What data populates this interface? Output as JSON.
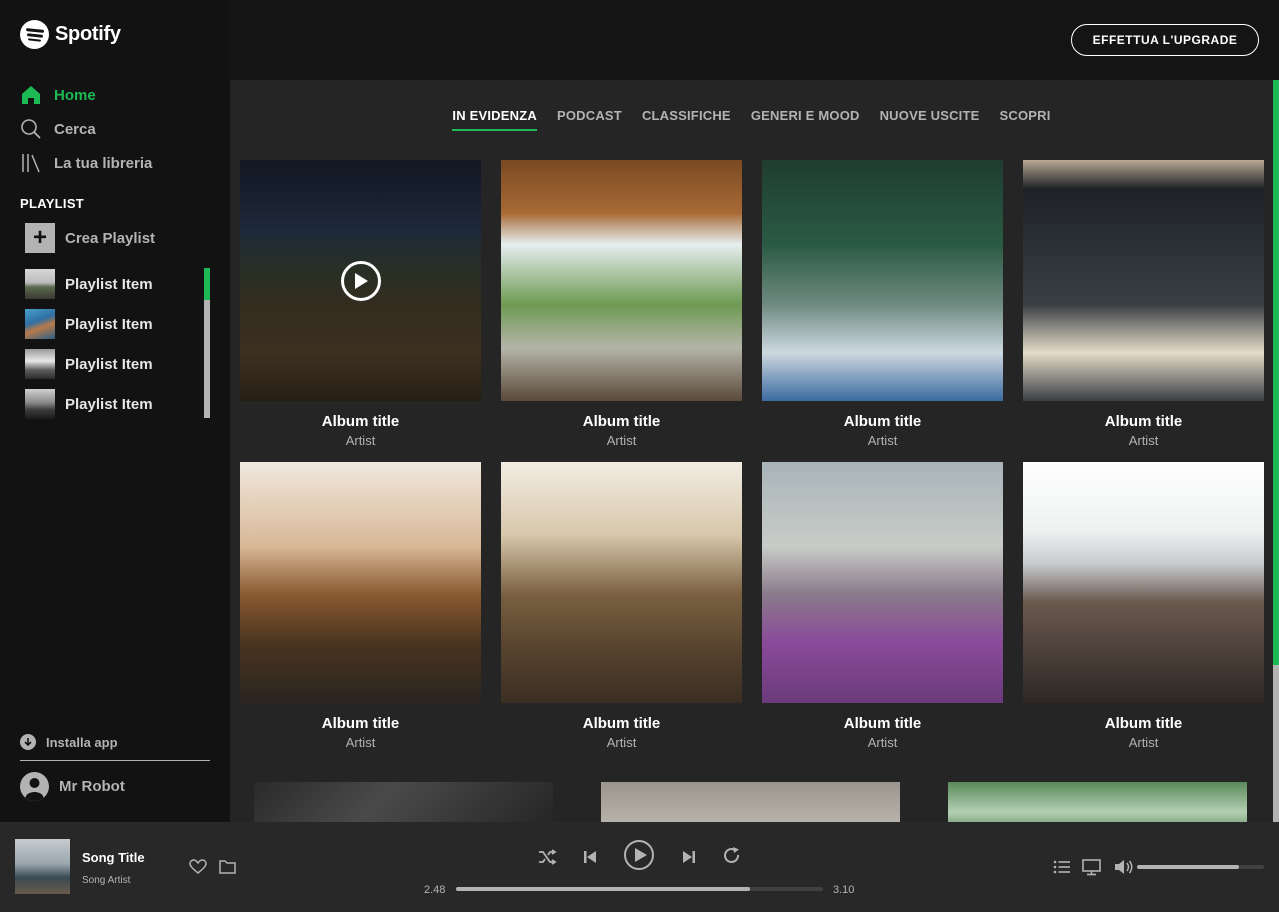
{
  "brand": {
    "name": "Spotify",
    "accent": "#1db954"
  },
  "sidebar": {
    "nav": [
      {
        "label": "Home",
        "icon": "home-icon",
        "active": true
      },
      {
        "label": "Cerca",
        "icon": "search-icon",
        "active": false
      },
      {
        "label": "La tua libreria",
        "icon": "library-icon",
        "active": false
      }
    ],
    "playlist_header": "PLAYLIST",
    "create_label": "Crea Playlist",
    "playlists": [
      {
        "label": "Playlist Item"
      },
      {
        "label": "Playlist Item"
      },
      {
        "label": "Playlist Item"
      },
      {
        "label": "Playlist Item"
      }
    ],
    "install_label": "Installa app",
    "user_name": "Mr Robot"
  },
  "topbar": {
    "upgrade_label": "EFFETTUA L'UPGRADE"
  },
  "main": {
    "tabs": [
      {
        "label": "IN EVIDENZA",
        "active": true
      },
      {
        "label": "PODCAST",
        "active": false
      },
      {
        "label": "CLASSIFICHE",
        "active": false
      },
      {
        "label": "GENERI E MOOD",
        "active": false
      },
      {
        "label": "NUOVE USCITE",
        "active": false
      },
      {
        "label": "SCOPRI",
        "active": false
      }
    ],
    "albums": [
      {
        "title": "Album title",
        "artist": "Artist"
      },
      {
        "title": "Album title",
        "artist": "Artist"
      },
      {
        "title": "Album title",
        "artist": "Artist"
      },
      {
        "title": "Album title",
        "artist": "Artist"
      },
      {
        "title": "Album title",
        "artist": "Artist"
      },
      {
        "title": "Album title",
        "artist": "Artist"
      },
      {
        "title": "Album title",
        "artist": "Artist"
      },
      {
        "title": "Album title",
        "artist": "Artist"
      }
    ]
  },
  "player": {
    "song_title": "Song Title",
    "song_artist": "Song Artist",
    "elapsed": "2.48",
    "duration": "3.10",
    "progress": 0.8,
    "volume": 0.8
  }
}
